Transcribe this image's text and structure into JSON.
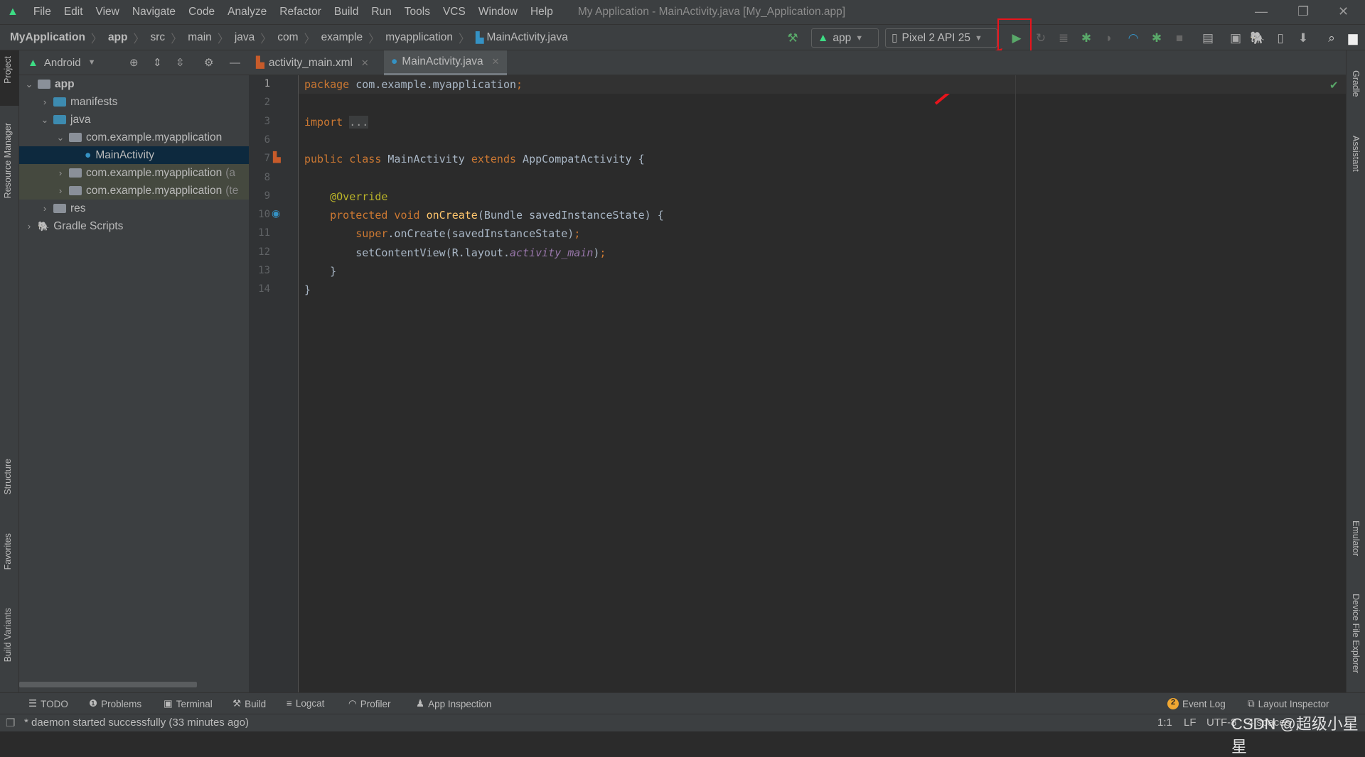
{
  "window": {
    "title": "My Application - MainActivity.java [My_Application.app]"
  },
  "menu": [
    "File",
    "Edit",
    "View",
    "Navigate",
    "Code",
    "Analyze",
    "Refactor",
    "Build",
    "Run",
    "Tools",
    "VCS",
    "Window",
    "Help"
  ],
  "breadcrumb": [
    "MyApplication",
    "app",
    "src",
    "main",
    "java",
    "com",
    "example",
    "myapplication",
    "MainActivity.java"
  ],
  "toolbar": {
    "config": "app",
    "device": "Pixel 2 API 25",
    "run_highlighted": true,
    "highlight_color": "#e8141c"
  },
  "project": {
    "view": "Android",
    "tree": [
      {
        "label": "app",
        "depth": 0,
        "expanded": true,
        "bold": true
      },
      {
        "label": "manifests",
        "depth": 1,
        "expanded": false
      },
      {
        "label": "java",
        "depth": 1,
        "expanded": true
      },
      {
        "label": "com.example.myapplication",
        "depth": 2,
        "expanded": true
      },
      {
        "label": "MainActivity",
        "depth": 3,
        "selected": true
      },
      {
        "label": "com.example.myapplication",
        "suffix": "(a",
        "depth": 2,
        "expanded": false,
        "test": true
      },
      {
        "label": "com.example.myapplication",
        "suffix": "(te",
        "depth": 2,
        "expanded": false,
        "test": true
      },
      {
        "label": "res",
        "depth": 1,
        "expanded": false
      },
      {
        "label": "Gradle Scripts",
        "depth": 0,
        "expanded": false
      }
    ]
  },
  "tabs": [
    {
      "label": "activity_main.xml",
      "active": false
    },
    {
      "label": "MainActivity.java",
      "active": true
    }
  ],
  "editor": {
    "lines": [
      {
        "n": "1",
        "html": "<span class='k'>package</span> com.example.myapplication<span class='k'>;</span>"
      },
      {
        "n": "2",
        "html": ""
      },
      {
        "n": "3",
        "html": "<span class='k'>import</span> <span style='background:#3b3d3e;color:#999'>...</span>"
      },
      {
        "n": "6",
        "html": ""
      },
      {
        "n": "7",
        "html": "<span class='k'>public class</span> MainActivity <span class='k'>extends</span> AppCompatActivity {"
      },
      {
        "n": "8",
        "html": ""
      },
      {
        "n": "9",
        "html": "    <span class='a'>@Override</span>"
      },
      {
        "n": "10",
        "html": "    <span class='k'>protected void</span> <span class='f'>onCreate</span>(Bundle savedInstanceState) {"
      },
      {
        "n": "11",
        "html": "        <span class='k'>super</span>.onCreate(savedInstanceState)<span class='k'>;</span>"
      },
      {
        "n": "12",
        "html": "        setContentView(R.layout.<span class='p'>activity_main</span>)<span class='k'>;</span>"
      },
      {
        "n": "13",
        "html": "    }"
      },
      {
        "n": "14",
        "html": "}"
      }
    ]
  },
  "left_tools": [
    "Project",
    "Resource Manager",
    "Structure",
    "Favorites",
    "Build Variants"
  ],
  "right_tools": [
    "Gradle",
    "Assistant",
    "Emulator",
    "Device File Explorer"
  ],
  "bottom_tools": [
    "TODO",
    "Problems",
    "Terminal",
    "Build",
    "Logcat",
    "Profiler",
    "App Inspection"
  ],
  "bottom_right": {
    "event_log": "Event Log",
    "event_count": "2",
    "layout_inspector": "Layout Inspector"
  },
  "status": {
    "message": "* daemon started successfully (33 minutes ago)",
    "position": "1:1",
    "line_sep": "LF",
    "encoding": "UTF-8",
    "indent": "4 spaces"
  },
  "watermark": "CSDN @超级小星星"
}
